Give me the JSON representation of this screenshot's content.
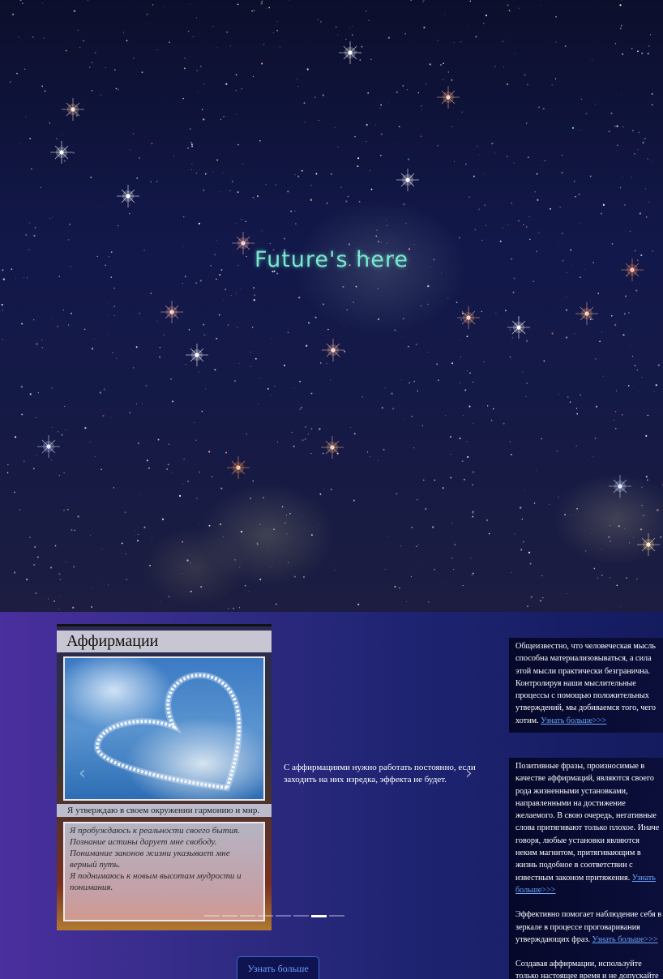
{
  "hero": {
    "title": "Future's here"
  },
  "affirmations_card": {
    "title": "Аффирмации",
    "caption": "Я утверждаю в своем окружении гармонию и мир.",
    "quote_lines": [
      "Я пробуждаюсь к реальности своего бытия.",
      "Познание истины дарует мне свободу.",
      "Понимание законов жизни указывает мне верный путь.",
      "Я поднимаюсь к новым высотам мудрости и понимания."
    ]
  },
  "slider": {
    "text": "С аффирмациями нужно работать постоянно, если заходить на них изредка, эффекта не будет.",
    "prev_icon": "chevron-left-icon",
    "next_icon": "chevron-right-icon",
    "dots_count": 8,
    "active_dot": 6
  },
  "more_button": {
    "label": "Узнать больше"
  },
  "side_blocks": [
    {
      "paragraphs": [
        {
          "text": "Общеизвестно, что человеческая мысль способна материализовываться, а сила этой мысли практически безгранична. Контролируя наши мыслительные процессы с помощью положительных утверждений, мы добиваемся того, чего хотим.",
          "link": "Узнать больше>>>"
        }
      ]
    },
    {
      "paragraphs": [
        {
          "text": "Позитивные фразы, произносимые в качестве аффирмаций, являются своего рода жизненными установками, направленными на достижение желаемого. В свою очередь, негативные слова притягивают только плохое. Иначе говоря, любые установки являются неким магнитом, притягивающим в жизнь подобное в соответствии с известным законом притяжения.",
          "link": "Узнать больше>>>"
        },
        {
          "text": "Эффективно помогает наблюдение себя в зеркале в процессе проговаривания утверждающих фраз.",
          "link": "Узнать больше>>>"
        },
        {
          "text": "Создавая аффирмации, используйте только настоящее время и не допускайте негативного контекста. Как уже",
          "link": ""
        }
      ]
    }
  ],
  "colors": {
    "hero_title": "#79e8cf",
    "link": "#6fa7ff",
    "section_bg_left": "#4a2f9e",
    "section_bg_right": "#141b5e"
  }
}
